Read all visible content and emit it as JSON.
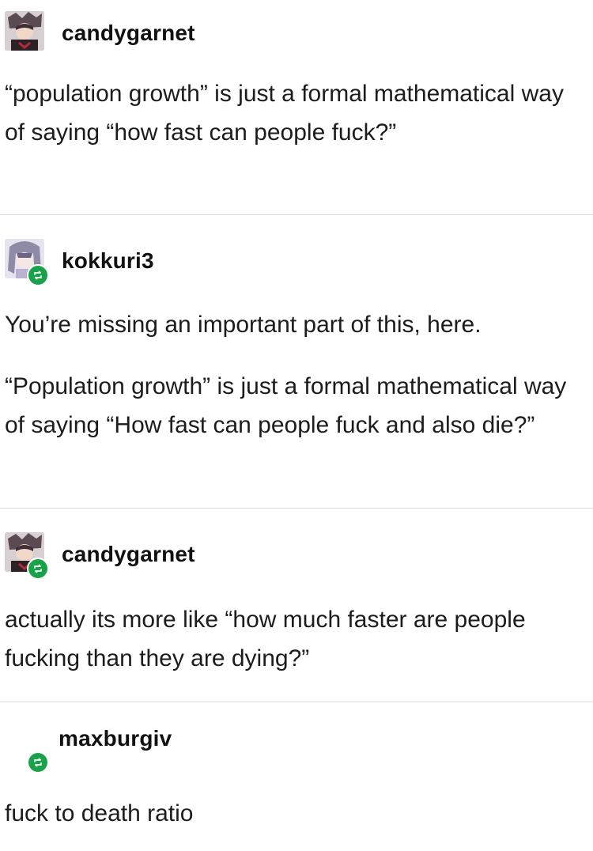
{
  "posts": [
    {
      "username": "candygarnet",
      "avatar": "anime-character-avatar",
      "reblog": false,
      "paragraphs": [
        "“population growth” is just a formal mathematical way of saying “how fast can people fuck?”"
      ]
    },
    {
      "username": "kokkuri3",
      "avatar": "anime-girl-avatar",
      "reblog": true,
      "paragraphs": [
        "You’re missing an important part of this, here.",
        "“Population growth” is just a formal mathematical way of saying “How fast can people fuck and also die?”"
      ]
    },
    {
      "username": "candygarnet",
      "avatar": "anime-character-avatar",
      "reblog": true,
      "paragraphs": [
        "actually its more like “how much faster are people fucking than they are dying?”"
      ]
    },
    {
      "username": "maxburgiv",
      "avatar": "none",
      "reblog": true,
      "paragraphs": [
        "fuck to death ratio"
      ]
    }
  ],
  "colors": {
    "reblog_badge": "#19a24a",
    "divider": "#d9d9d9",
    "text": "#1c1c1c"
  }
}
